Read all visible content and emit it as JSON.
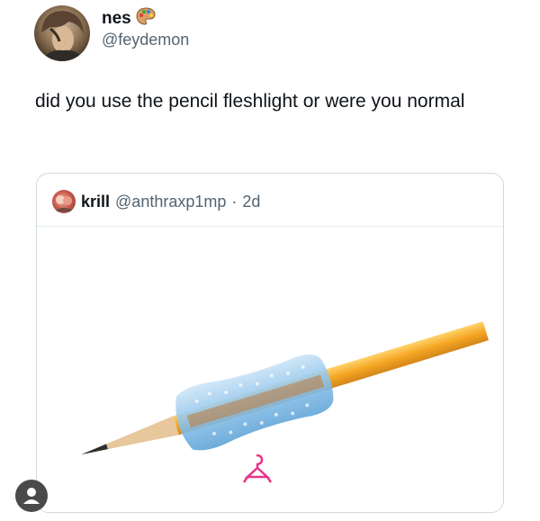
{
  "author": {
    "display_name": "nes",
    "emoji_badge": "palette-icon",
    "handle": "@feydemon",
    "avatar": "profile-avatar"
  },
  "tweet": {
    "text": "did you use the pencil fleshlight or were you normal"
  },
  "quoted_tweet": {
    "display_name": "krill",
    "handle": "@anthraxp1mp",
    "separator": "·",
    "time": "2d",
    "avatar": "profile-avatar",
    "image": "pencil-grip-photo"
  },
  "overlay": {
    "icon": "user-icon"
  },
  "colors": {
    "text": "#0f1419",
    "secondary": "#536471",
    "border": "#cfd9de"
  }
}
